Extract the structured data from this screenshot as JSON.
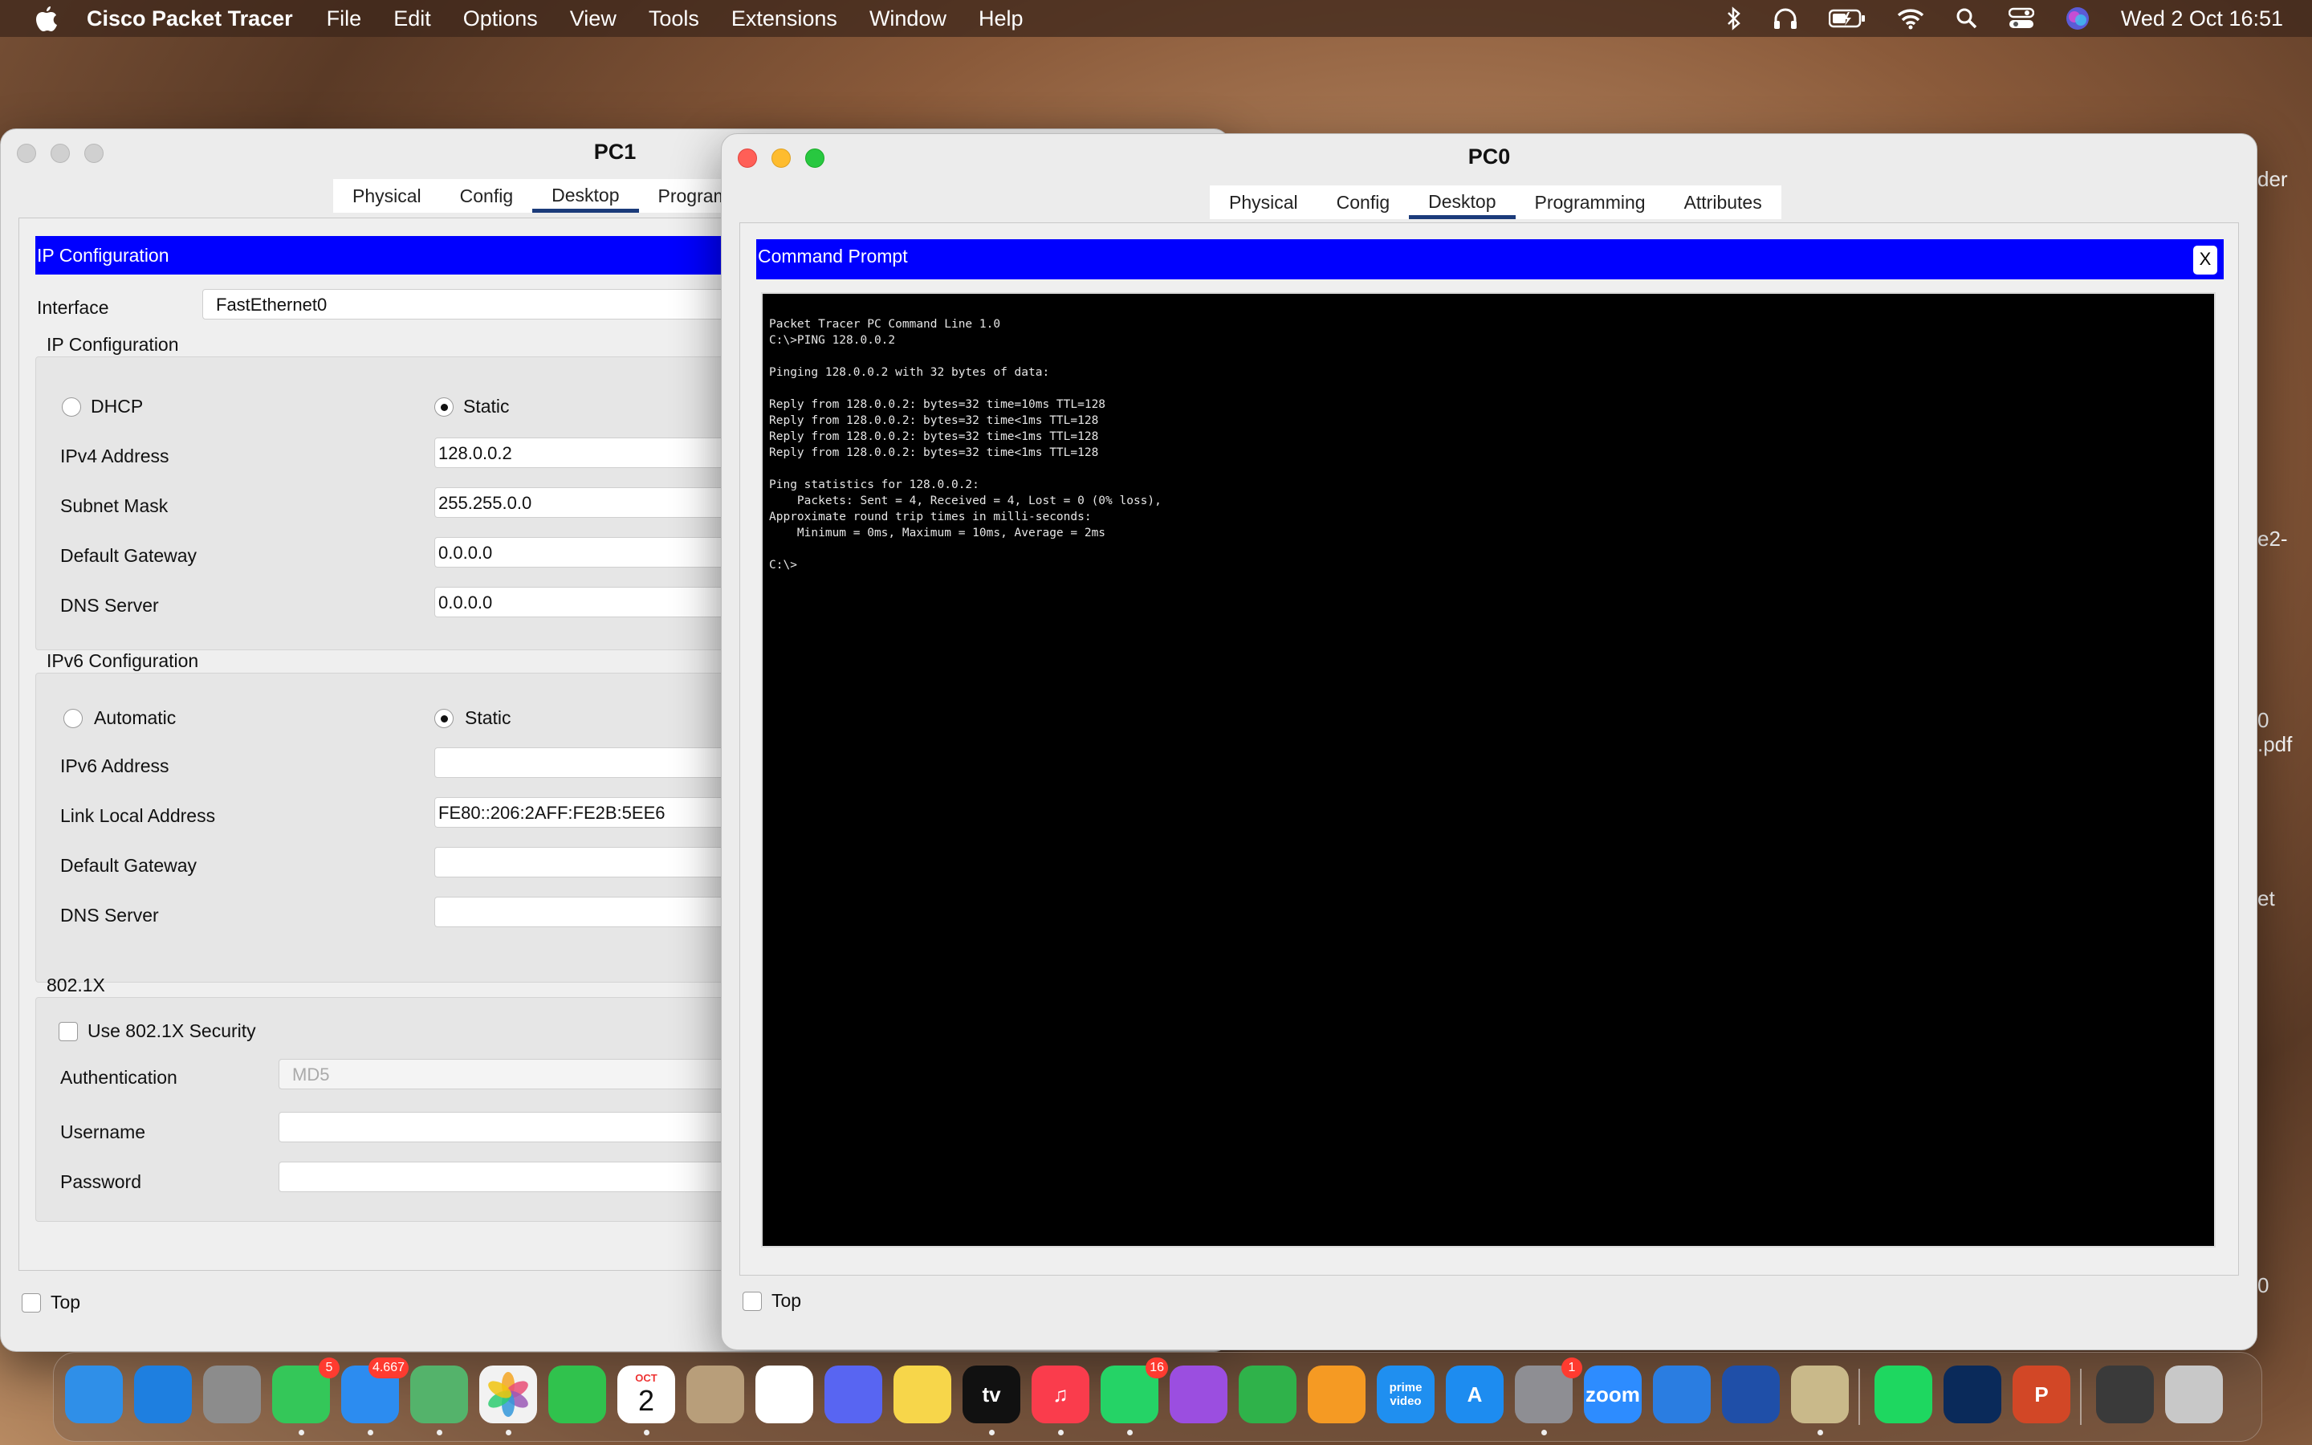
{
  "menubar": {
    "app_name": "Cisco Packet Tracer",
    "items": [
      "File",
      "Edit",
      "Options",
      "View",
      "Tools",
      "Extensions",
      "Window",
      "Help"
    ],
    "clock": "Wed 2 Oct  16:51"
  },
  "pc1": {
    "title": "PC1",
    "tabs": [
      "Physical",
      "Config",
      "Desktop",
      "Programm"
    ],
    "active_tab": "Desktop",
    "band_title": "IP Configuration",
    "interface_label": "Interface",
    "interface_value": "FastEthernet0",
    "ipv4_section": "IP Configuration",
    "dhcp_label": "DHCP",
    "static_label": "Static",
    "ipv4_mode": "Static",
    "ipv4_address_label": "IPv4 Address",
    "ipv4_address": "128.0.0.2",
    "subnet_label": "Subnet Mask",
    "subnet": "255.255.0.0",
    "gateway_label": "Default Gateway",
    "gateway": "0.0.0.0",
    "dns_label": "DNS Server",
    "dns": "0.0.0.0",
    "ipv6_section": "IPv6 Configuration",
    "automatic_label": "Automatic",
    "static6_label": "Static",
    "ipv6_mode": "Static",
    "ipv6_address_label": "IPv6 Address",
    "ipv6_address": "",
    "link_local_label": "Link Local Address",
    "link_local": "FE80::206:2AFF:FE2B:5EE6",
    "gateway6_label": "Default Gateway",
    "gateway6": "",
    "dns6_label": "DNS Server",
    "dns6": "",
    "dot1x_section": "802.1X",
    "use_8021x_label": "Use 802.1X Security",
    "use_8021x": false,
    "auth_label": "Authentication",
    "auth_value": "MD5",
    "username_label": "Username",
    "username": "",
    "password_label": "Password",
    "password": "",
    "top_label": "Top"
  },
  "pc0": {
    "title": "PC0",
    "tabs": [
      "Physical",
      "Config",
      "Desktop",
      "Programming",
      "Attributes"
    ],
    "active_tab": "Desktop",
    "band_title": "Command Prompt",
    "close_label": "X",
    "terminal_lines": [
      "Packet Tracer PC Command Line 1.0",
      "C:\\>PING 128.0.0.2",
      "",
      "Pinging 128.0.0.2 with 32 bytes of data:",
      "",
      "Reply from 128.0.0.2: bytes=32 time=10ms TTL=128",
      "Reply from 128.0.0.2: bytes=32 time<1ms TTL=128",
      "Reply from 128.0.0.2: bytes=32 time<1ms TTL=128",
      "Reply from 128.0.0.2: bytes=32 time<1ms TTL=128",
      "",
      "Ping statistics for 128.0.0.2:",
      "    Packets: Sent = 4, Received = 4, Lost = 0 (0% loss),",
      "Approximate round trip times in milli-seconds:",
      "    Minimum = 0ms, Maximum = 10ms, Average = 2ms",
      "",
      "C:\\>"
    ],
    "top_label": "Top"
  },
  "background_labels": [
    "der",
    "e2-",
    "0",
    ".pdf",
    "et",
    "0"
  ],
  "dock": {
    "apps": [
      {
        "name": "finder-icon",
        "label": "",
        "color": "#2f8fe8"
      },
      {
        "name": "safari-icon",
        "label": "",
        "color": "#1e7fe0"
      },
      {
        "name": "launchpad-icon",
        "label": "",
        "color": "#8c8c8c"
      },
      {
        "name": "messages-icon",
        "label": "",
        "color": "#34c759",
        "badge": "5"
      },
      {
        "name": "mail-icon",
        "label": "",
        "color": "#2c8cf0",
        "badge": "4.667"
      },
      {
        "name": "maps-icon",
        "label": "",
        "color": "#54b36b"
      },
      {
        "name": "photos-icon",
        "label": "",
        "color": "#f2f2f2"
      },
      {
        "name": "facetime-icon",
        "label": "",
        "color": "#30c24d"
      },
      {
        "name": "calendar-icon",
        "label": "2",
        "month": "OCT",
        "color": "#ffffff"
      },
      {
        "name": "contacts-icon",
        "label": "",
        "color": "#b89e7a"
      },
      {
        "name": "reminders-icon",
        "label": "",
        "color": "#ffffff"
      },
      {
        "name": "discord-icon",
        "label": "",
        "color": "#5865f2"
      },
      {
        "name": "notes-icon",
        "label": "",
        "color": "#f7d64a"
      },
      {
        "name": "appletv-icon",
        "label": "tv",
        "color": "#111111"
      },
      {
        "name": "music-icon",
        "label": "♫",
        "color": "#fa3c4c"
      },
      {
        "name": "whatsapp-icon",
        "label": "",
        "color": "#25d366",
        "badge": "16"
      },
      {
        "name": "podcasts-icon",
        "label": "",
        "color": "#9b4ee0"
      },
      {
        "name": "numbers-icon",
        "label": "",
        "color": "#2fb24a"
      },
      {
        "name": "pages-icon",
        "label": "",
        "color": "#f59a23"
      },
      {
        "name": "primevideo-icon",
        "label": "prime video",
        "color": "#1f8ff0"
      },
      {
        "name": "appstore-icon",
        "label": "A",
        "color": "#1d8cf0"
      },
      {
        "name": "system-settings-icon",
        "label": "",
        "color": "#8e8e93",
        "badge": "1"
      },
      {
        "name": "zoom-icon",
        "label": "zoom",
        "color": "#2d8cff"
      },
      {
        "name": "keynote-icon",
        "label": "",
        "color": "#2a7de1"
      },
      {
        "name": "packet-tracer-icon",
        "label": "",
        "color": "#1f4fa8"
      },
      {
        "name": "preview-icon",
        "label": "",
        "color": "#c9b98a"
      },
      {
        "name": "spotify-icon",
        "label": "",
        "color": "#1ed760"
      },
      {
        "name": "webex-icon",
        "label": "",
        "color": "#0a2a5a"
      },
      {
        "name": "powerpoint-icon",
        "label": "P",
        "color": "#d24726"
      },
      {
        "name": "downloads-stack-icon",
        "label": "",
        "color": "#3a3a3a"
      },
      {
        "name": "trash-icon",
        "label": "",
        "color": "#c8c8c8"
      }
    ]
  }
}
